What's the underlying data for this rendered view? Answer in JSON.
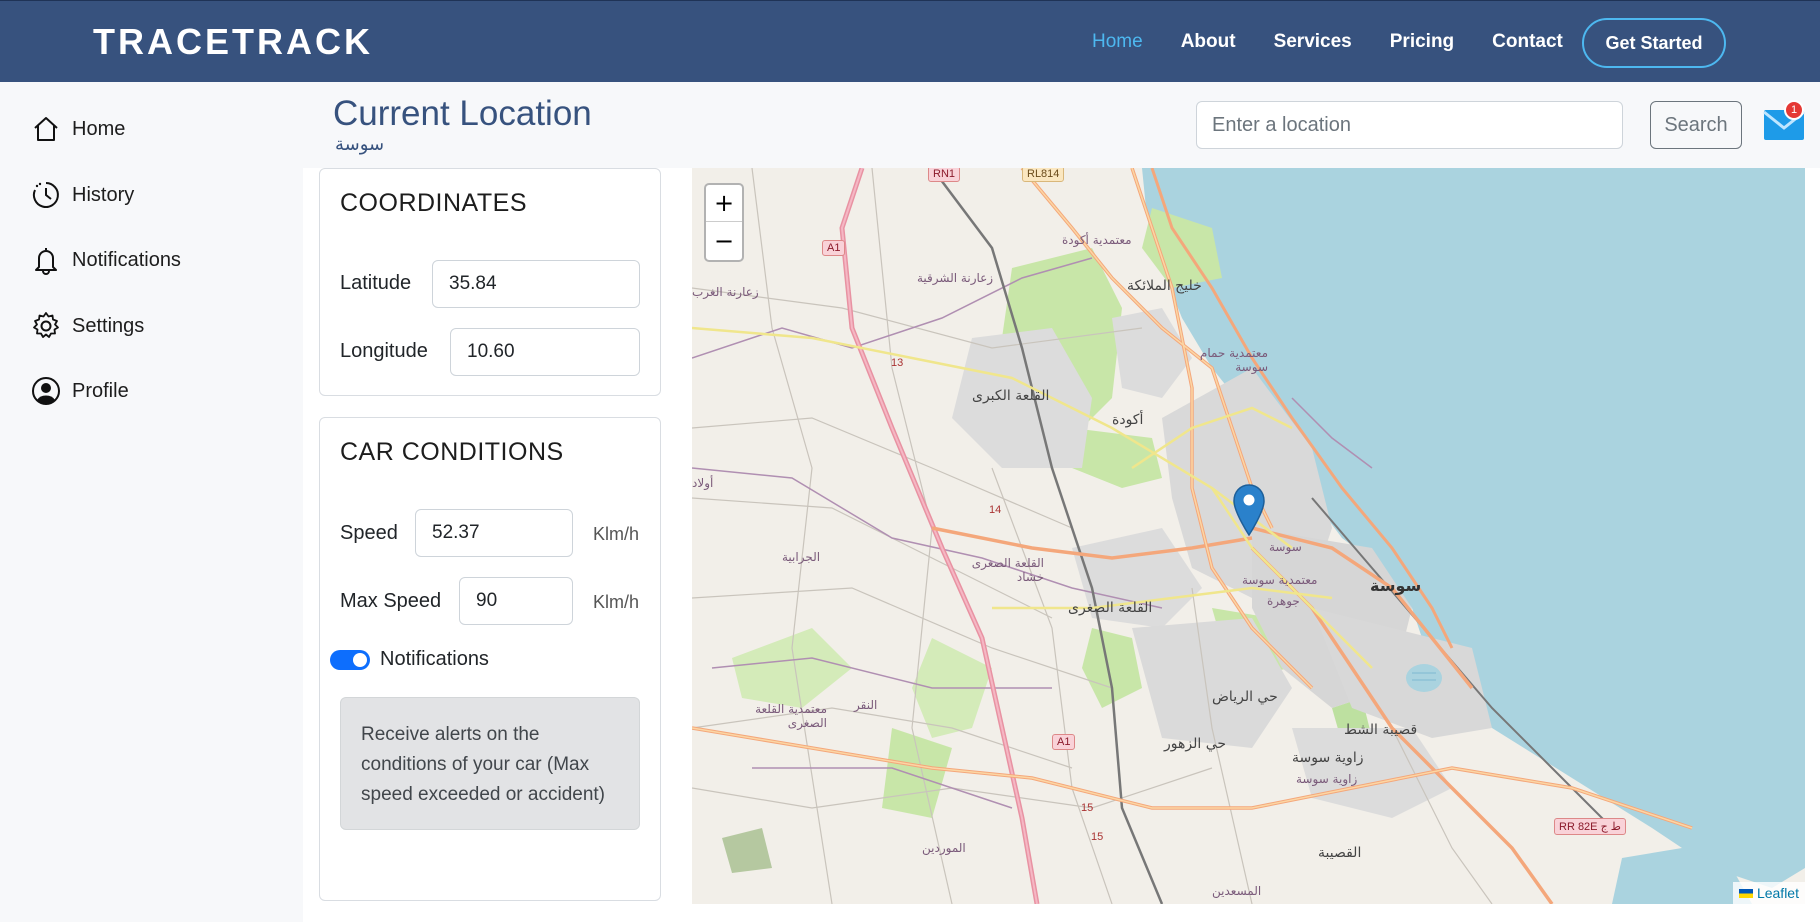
{
  "navbar": {
    "brand": "TRACETRACK",
    "links": [
      "Home",
      "About",
      "Services",
      "Pricing",
      "Contact"
    ],
    "active_link": "Home",
    "cta_label": "Get Started"
  },
  "sidebar": {
    "items": [
      {
        "label": "Home",
        "icon": "home-icon"
      },
      {
        "label": "History",
        "icon": "history-icon"
      },
      {
        "label": "Notifications",
        "icon": "bell-icon"
      },
      {
        "label": "Settings",
        "icon": "gear-icon"
      },
      {
        "label": "Profile",
        "icon": "user-icon"
      }
    ]
  },
  "header": {
    "title": "Current Location",
    "subtitle": "سوسة",
    "search_placeholder": "Enter a location",
    "search_label": "Search",
    "mail_badge": "1"
  },
  "coordinates": {
    "title": "COORDINATES",
    "latitude_label": "Latitude",
    "latitude_value": "35.84",
    "longitude_label": "Longitude",
    "longitude_value": "10.60"
  },
  "car_conditions": {
    "title": "CAR CONDITIONS",
    "speed_label": "Speed",
    "speed_value": "52.37",
    "speed_unit": "Klm/h",
    "max_speed_label": "Max Speed",
    "max_speed_value": "90",
    "max_speed_unit": "Klm/h",
    "notifications_label": "Notifications",
    "notifications_enabled": true,
    "alert_text": "Receive alerts on the conditions of your car (Max speed exceeded or accident)"
  },
  "map": {
    "zoom_in": "+",
    "zoom_out": "−",
    "attribution": "Leaflet",
    "colors": {
      "land": "#f2efe9",
      "sea": "#aad3df",
      "park": "#c8e6a8",
      "urban": "#d9d9d9",
      "motorway": "#e892a2",
      "primary": "#fcd6a4"
    },
    "labels": {
      "rn1": "RN1",
      "rl814": "RL814",
      "a1_top": "A1",
      "a1_bottom": "A1",
      "r13": "13",
      "r14": "14",
      "r15a": "15",
      "r15b": "15",
      "rr82e": "RR 82E ط ج",
      "akouda_del": "معتمدية أكودة",
      "zaouiet_sharqia": "زعارنة الشرقية",
      "zaouiet_gharb": "زعارنة الغرب",
      "khelij": "خليج الملائكة",
      "hammam_del": "معتمدية حمام سوسة",
      "kalaa_kebira": "القلعة الكبرى",
      "akouda": "أكودة",
      "ouled": "أولاد",
      "jerabia": "الجرابية",
      "kalaa_soghra_del": "القلعة الصغرى خشاد",
      "kalaa_soghra": "القلعة الصغرى",
      "sousse_neighborhood": "سوسة",
      "sousse_del": "معتمدية سوسة",
      "jawhara": "جوهرة",
      "sousse_city": "سوسة",
      "riadh": "حي الرياض",
      "zouhour": "حي الزهور",
      "qasiba": "قصيبة الشط",
      "zaouiet_sousse": "زاوية سوسة",
      "zaouiet_sousse2": "زاوية سوسة",
      "kalaa_soghra_del2": "معتمدية القلعة الصغرى",
      "naqr": "النقر",
      "mouradine": "الموردين",
      "qusaiba": "القصيبة",
      "msaadin": "المسعدين"
    }
  }
}
